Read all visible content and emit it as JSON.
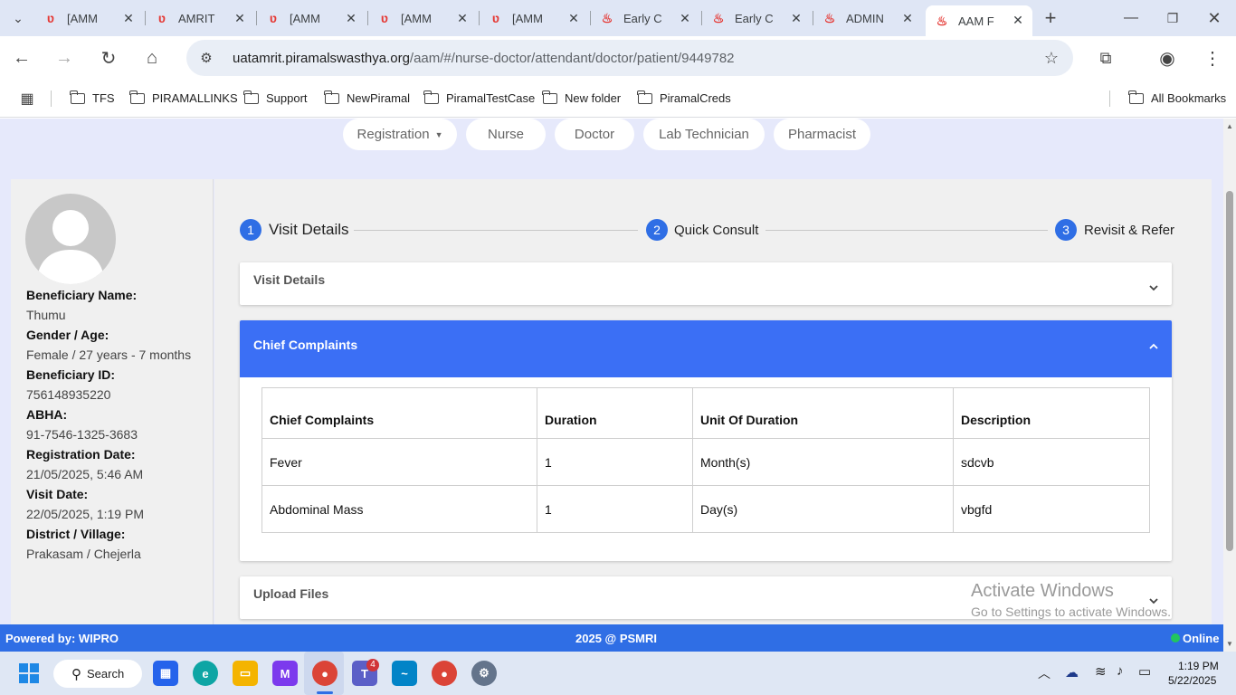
{
  "browser": {
    "tabs": [
      {
        "title": "[AMM"
      },
      {
        "title": "AMRIT"
      },
      {
        "title": "[AMM"
      },
      {
        "title": "[AMM"
      },
      {
        "title": "[AMM"
      },
      {
        "title": "Early C"
      },
      {
        "title": "Early C"
      },
      {
        "title": "ADMIN"
      },
      {
        "title": "AAM F"
      }
    ],
    "url_host": "uatamrit.piramalswasthya.org",
    "url_path": "/aam/#/nurse-doctor/attendant/doctor/patient/9449782",
    "bookmarks": [
      "TFS",
      "PIRAMALLINKS",
      "Support",
      "NewPiramal",
      "PiramalTestCase",
      "New folder",
      "PiramalCreds"
    ],
    "all_bookmarks": "All Bookmarks"
  },
  "nav": {
    "registration": "Registration",
    "nurse": "Nurse",
    "doctor": "Doctor",
    "lab": "Lab Technician",
    "pharmacist": "Pharmacist"
  },
  "beneficiary": {
    "name_label": "Beneficiary Name:",
    "name": "Thumu",
    "gender_label": "Gender / Age:",
    "gender": "Female / 27 years - 7 months",
    "id_label": "Beneficiary ID:",
    "id": "756148935220",
    "abha_label": "ABHA:",
    "abha": "91-7546-1325-3683",
    "reg_label": "Registration Date:",
    "reg": "21/05/2025, 5:46 AM",
    "visit_label": "Visit Date:",
    "visit": "22/05/2025, 1:19 PM",
    "district_label": "District / Village:",
    "district": "Prakasam / Chejerla"
  },
  "stepper": [
    {
      "num": "1",
      "label": "Visit Details"
    },
    {
      "num": "2",
      "label": "Quick Consult"
    },
    {
      "num": "3",
      "label": "Revisit & Refer"
    }
  ],
  "panels": {
    "visit_details": "Visit Details",
    "chief_complaints": "Chief Complaints",
    "upload_files": "Upload Files"
  },
  "complaints_table": {
    "headers": [
      "Chief Complaints",
      "Duration",
      "Unit Of Duration",
      "Description"
    ],
    "rows": [
      [
        "Fever",
        "1",
        "Month(s)",
        "sdcvb"
      ],
      [
        "Abdominal Mass",
        "1",
        "Day(s)",
        "vbgfd"
      ]
    ]
  },
  "footer": {
    "powered": "Powered by: WIPRO",
    "copyright": "2025 @ PSMRI",
    "status": "Online"
  },
  "watermark": {
    "line1": "Activate Windows",
    "line2": "Go to Settings to activate Windows."
  },
  "taskbar": {
    "search": "Search",
    "time": "1:19 PM",
    "date": "5/22/2025",
    "teams_badge": "4"
  },
  "colors": {
    "primary": "#2f6ee5",
    "page_bg": "#e6e9fb",
    "card_bg": "#f0f0f0",
    "online": "#22c55e"
  }
}
